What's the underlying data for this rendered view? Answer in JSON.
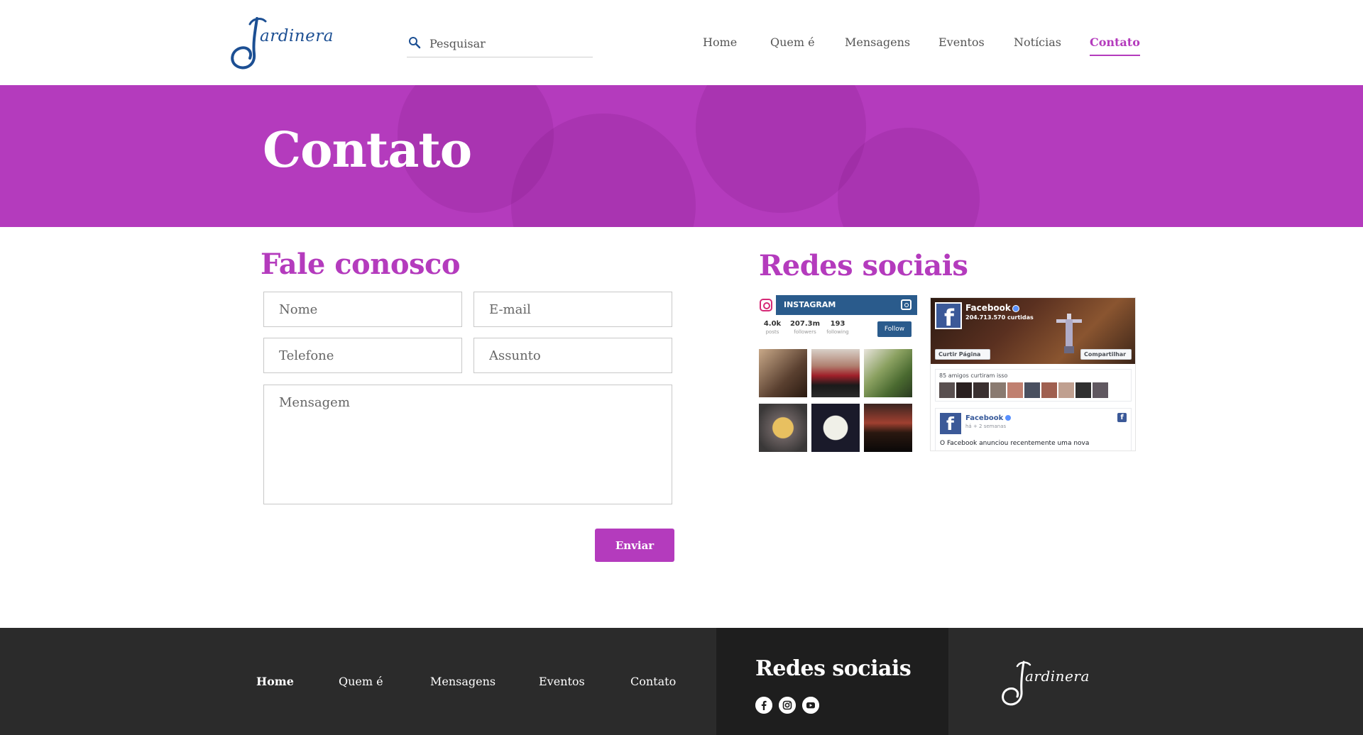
{
  "brand": {
    "logo_text": "ardinera",
    "primary_color": "#b43bbd",
    "logo_color": "#1c4f93"
  },
  "search": {
    "placeholder": "Pesquisar",
    "icon": "search-icon"
  },
  "nav": {
    "items": [
      {
        "label": "Home"
      },
      {
        "label": "Quem é"
      },
      {
        "label": "Mensagens"
      },
      {
        "label": "Eventos"
      },
      {
        "label": "Notícias"
      },
      {
        "label": "Contato",
        "active": true
      }
    ]
  },
  "banner": {
    "title": "Contato"
  },
  "contact_form": {
    "title": "Fale conosco",
    "fields": {
      "name_placeholder": "Nome",
      "email_placeholder": "E-mail",
      "phone_placeholder": "Telefone",
      "subject_placeholder": "Assunto",
      "message_placeholder": "Mensagem"
    },
    "submit_label": "Enviar"
  },
  "social_section": {
    "title": "Redes sociais",
    "instagram": {
      "label": "INSTAGRAM",
      "stats": [
        {
          "value": "4.0k",
          "label": "posts"
        },
        {
          "value": "207.3m",
          "label": "followers"
        },
        {
          "value": "193",
          "label": "following"
        }
      ],
      "follow_label": "Follow"
    },
    "facebook": {
      "page_name": "Facebook",
      "likes": "204.713.570 curtidas",
      "like_button": "Curtir Página",
      "share_button": "Compartilhar",
      "friends_text": "85 amigos curtiram isso",
      "post_author": "Facebook",
      "post_time": "há + 2 semanas",
      "post_text": "O Facebook anunciou recentemente uma nova"
    }
  },
  "footer": {
    "nav": [
      {
        "label": "Home",
        "active": true
      },
      {
        "label": "Quem é"
      },
      {
        "label": "Mensagens"
      },
      {
        "label": "Eventos"
      },
      {
        "label": "Contato"
      }
    ],
    "social_title": "Redes sociais",
    "social_icons": [
      "facebook-icon",
      "instagram-icon",
      "youtube-icon"
    ],
    "logo_text": "ardinera"
  }
}
